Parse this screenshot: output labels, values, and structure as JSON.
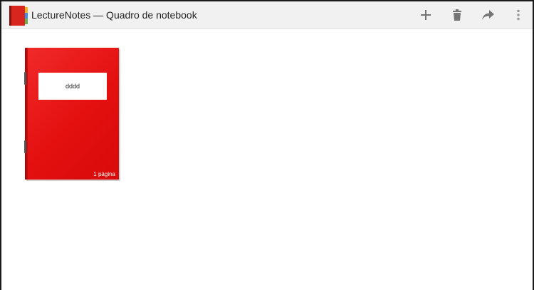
{
  "app": {
    "title": "LectureNotes — Quadro de notebook",
    "icon": "notebook-app-icon"
  },
  "toolbar": {
    "actions": [
      {
        "name": "add-icon"
      },
      {
        "name": "delete-icon"
      },
      {
        "name": "share-icon"
      },
      {
        "name": "more-options-icon"
      }
    ]
  },
  "notebooks": [
    {
      "label": "dddd",
      "pages": "1 página",
      "cover_color": "#e41010"
    }
  ],
  "colors": {
    "action_bar": "#f1f1f1",
    "cover": "#e41010",
    "icon_gray": "#757575"
  }
}
